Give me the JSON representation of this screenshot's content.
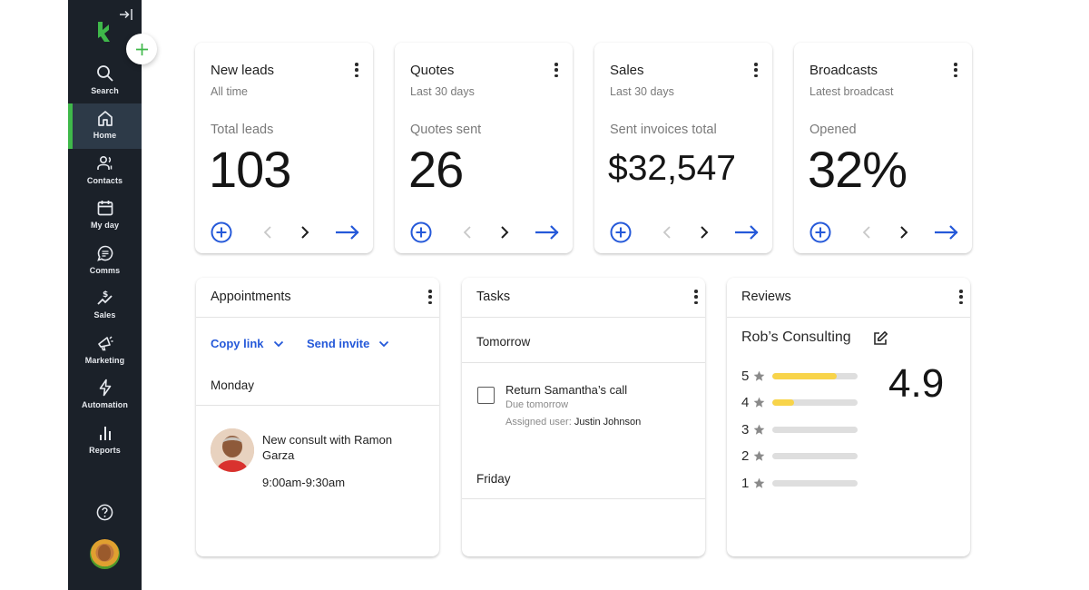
{
  "sidebar": {
    "collapse_icon": "collapse-sidebar-icon",
    "logo_icon": "keap-logo-icon",
    "add_icon": "plus-icon",
    "items": [
      {
        "label": "Search",
        "icon": "search-icon"
      },
      {
        "label": "Home",
        "icon": "home-icon",
        "active": true
      },
      {
        "label": "Contacts",
        "icon": "contacts-icon"
      },
      {
        "label": "My day",
        "icon": "calendar-icon"
      },
      {
        "label": "Comms",
        "icon": "chat-icon"
      },
      {
        "label": "Sales",
        "icon": "sales-icon"
      },
      {
        "label": "Marketing",
        "icon": "megaphone-icon"
      },
      {
        "label": "Automation",
        "icon": "lightning-icon"
      },
      {
        "label": "Reports",
        "icon": "bar-chart-icon"
      }
    ],
    "help_icon": "help-icon",
    "user_avatar": "user-avatar"
  },
  "colors": {
    "sidebar_bg": "#1b2129",
    "active_bg": "#2d3a48",
    "brand_green": "#3fb84a",
    "link_blue": "#2559d9",
    "star_yellow": "#f8d44a"
  },
  "stat_cards": [
    {
      "title": "New leads",
      "subtitle": "All time",
      "label": "Total leads",
      "value": "103"
    },
    {
      "title": "Quotes",
      "subtitle": "Last 30 days",
      "label": "Quotes sent",
      "value": "26"
    },
    {
      "title": "Sales",
      "subtitle": "Last 30 days",
      "label": "Sent invoices total",
      "value": "$32,547"
    },
    {
      "title": "Broadcasts",
      "subtitle": "Latest broadcast",
      "label": "Opened",
      "value": "32%"
    }
  ],
  "appointments": {
    "title": "Appointments",
    "copy_link": "Copy link",
    "send_invite": "Send invite",
    "day": "Monday",
    "event": {
      "title": "New consult with Ramon Garza",
      "time": "9:00am-9:30am"
    }
  },
  "tasks": {
    "title": "Tasks",
    "groups": [
      {
        "day": "Tomorrow",
        "items": [
          {
            "title": "Return Samantha’s call",
            "due": "Due tomorrow",
            "assigned_label": "Assigned user:",
            "assigned_user": "Justin Johnson",
            "checked": false
          }
        ]
      },
      {
        "day": "Friday",
        "items": []
      }
    ]
  },
  "reviews": {
    "title": "Reviews",
    "business": "Rob’s Consulting",
    "average": "4.9",
    "distribution": [
      {
        "stars": "5",
        "fraction": 0.75
      },
      {
        "stars": "4",
        "fraction": 0.25
      },
      {
        "stars": "3",
        "fraction": 0
      },
      {
        "stars": "2",
        "fraction": 0
      },
      {
        "stars": "1",
        "fraction": 0
      }
    ]
  }
}
